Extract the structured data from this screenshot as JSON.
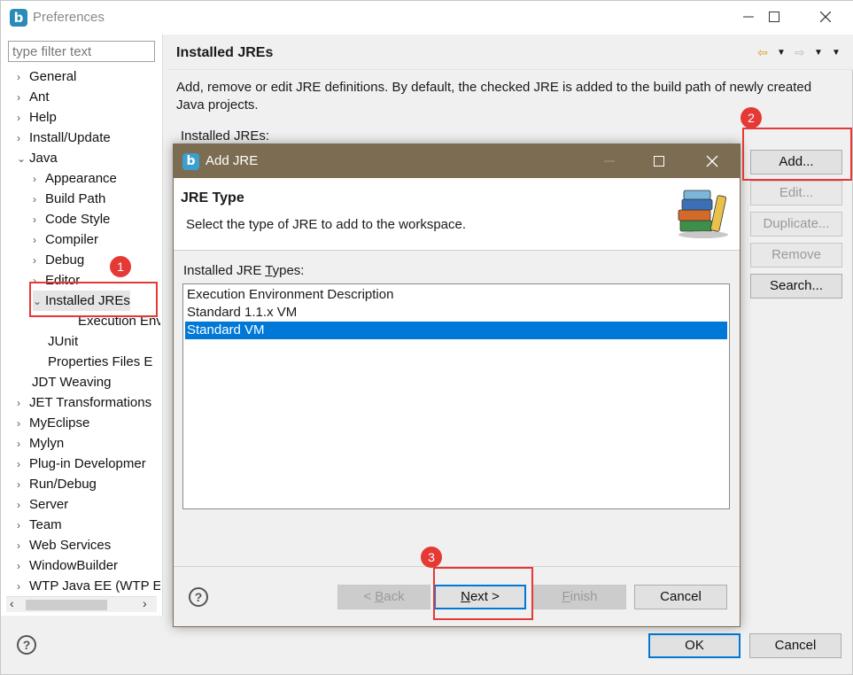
{
  "window": {
    "title": "Preferences",
    "app_icon_letter": "b"
  },
  "filter": {
    "placeholder": "type filter text"
  },
  "tree": [
    {
      "label": "General",
      "expanded": false
    },
    {
      "label": "Ant",
      "expanded": false
    },
    {
      "label": "Help",
      "expanded": false
    },
    {
      "label": "Install/Update",
      "expanded": false
    },
    {
      "label": "Java",
      "expanded": true
    },
    {
      "label": "Appearance",
      "expanded": false
    },
    {
      "label": "Build Path",
      "expanded": false
    },
    {
      "label": "Code Style",
      "expanded": false
    },
    {
      "label": "Compiler",
      "expanded": false
    },
    {
      "label": "Debug",
      "expanded": false
    },
    {
      "label": "Editor",
      "expanded": false
    },
    {
      "label": "Installed JREs",
      "expanded": true,
      "selected": true
    },
    {
      "label": "Execution Envi"
    },
    {
      "label": "JUnit"
    },
    {
      "label": "Properties Files E"
    },
    {
      "label": "JDT Weaving"
    },
    {
      "label": "JET Transformations",
      "expanded": false
    },
    {
      "label": "MyEclipse",
      "expanded": false
    },
    {
      "label": "Mylyn",
      "expanded": false
    },
    {
      "label": "Plug-in Developmer",
      "expanded": false
    },
    {
      "label": "Run/Debug",
      "expanded": false
    },
    {
      "label": "Server",
      "expanded": false
    },
    {
      "label": "Team",
      "expanded": false
    },
    {
      "label": "Web Services",
      "expanded": false
    },
    {
      "label": "WindowBuilder",
      "expanded": false
    },
    {
      "label": "WTP Java EE (WTP E",
      "expanded": false
    }
  ],
  "page": {
    "title": "Installed JREs",
    "description": "Add, remove or edit JRE definitions. By default, the checked JRE is added to the build path of newly created Java projects.",
    "list_label": "Installed JREs:"
  },
  "side_buttons": {
    "add": "Add...",
    "edit": "Edit...",
    "duplicate": "Duplicate...",
    "remove": "Remove",
    "search": "Search..."
  },
  "footer": {
    "ok": "OK",
    "cancel": "Cancel"
  },
  "dialog": {
    "title": "Add JRE",
    "banner_title": "JRE Type",
    "banner_desc": "Select the type of JRE to add to the workspace.",
    "types_label_pre": "Installed JRE ",
    "types_label_mn": "T",
    "types_label_post": "ypes:",
    "types": [
      {
        "label": "Execution Environment Description",
        "selected": false
      },
      {
        "label": "Standard 1.1.x VM",
        "selected": false
      },
      {
        "label": "Standard VM",
        "selected": true
      }
    ],
    "back_pre": "< ",
    "back_mn": "B",
    "back_post": "ack",
    "next_mn": "N",
    "next_post": "ext >",
    "finish_mn": "F",
    "finish_post": "inish",
    "cancel": "Cancel"
  },
  "annotations": [
    "1",
    "2",
    "3"
  ],
  "colors": {
    "accent": "#0078d7",
    "annotation": "#e53935",
    "dialog_titlebar": "#7b6c52"
  }
}
